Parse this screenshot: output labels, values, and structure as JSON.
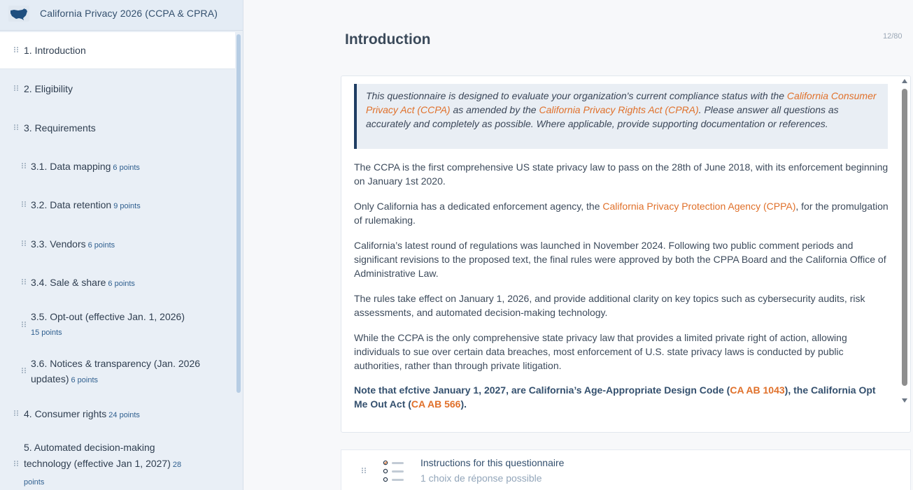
{
  "app": {
    "title": "California Privacy 2026 (CCPA & CPRA)"
  },
  "sidebar": {
    "items": [
      {
        "label": "1. Introduction",
        "points": ""
      },
      {
        "label": "2. Eligibility",
        "points": ""
      },
      {
        "label": "3. Requirements",
        "points": ""
      },
      {
        "label": "3.1. Data mapping",
        "points": "6 points"
      },
      {
        "label": "3.2. Data retention",
        "points": "9 points"
      },
      {
        "label": "3.3. Vendors",
        "points": "6 points"
      },
      {
        "label": "3.4. Sale & share",
        "points": "6 points"
      },
      {
        "label": "3.5. Opt-out (effective Jan. 1, 2026)",
        "points": "15 points"
      },
      {
        "label": "3.6. Notices & transparency (Jan. 2026 updates)",
        "points": "6 points"
      },
      {
        "label": "4. Consumer rights",
        "points": "24 points"
      },
      {
        "label": "5. Automated decision-making technology (effective Jan 1, 2027)",
        "points": "28 points"
      }
    ]
  },
  "main": {
    "title": "Introduction",
    "counter": "12/80",
    "quote": {
      "t1": "This questionnaire is designed to evaluate your organization's current compliance status with the ",
      "link1": "California Consumer Privacy Act (CCPA)",
      "t2": " as amended by the ",
      "link2": "California Privacy Rights Act (CPRA)",
      "t3": ". Please answer all questions as accurately and completely as possible. Where applicable, provide supporting documentation or references."
    },
    "p1": "The CCPA is the first comprehensive US state privacy law to pass on the 28th of June 2018, with its enforcement beginning on January 1st 2020.",
    "p2": {
      "t1": "Only California has a dedicated enforcement agency, the ",
      "link": "California Privacy Protection Agency (CPPA)",
      "t2": ", for the promulgation of rulemaking."
    },
    "p3": "California’s latest round of regulations was launched in November 2024. Following two public comment periods and significant revisions to the proposed text, the final rules were approved by both the CPPA Board and the California Office of Administrative Law.",
    "p4": "The rules take effect on January 1, 2026, and provide additional clarity on key topics such as cybersecurity audits, risk assessments, and automated decision-making technology.",
    "p5": "While the CCPA is the only comprehensive state privacy law that provides a limited private right of action, allowing individuals to sue over certain data breaches, most enforcement of U.S. state privacy laws is conducted by public authorities, rather than through private litigation.",
    "note": {
      "t1": "Note that efctive January 1, 2027, are California’s Age-Appropriate Design Code (",
      "link1": "CA AB 1043",
      "t2": "), the California Opt Me Out Act (",
      "link2": "CA AB 566",
      "t3": ")."
    },
    "instructions": {
      "title": "Instructions for this questionnaire",
      "subtitle": "1 choix de réponse possible"
    }
  },
  "colors": {
    "accent": "#e0702a",
    "navy": "#1f3d63",
    "sidebar_bg": "#e9eff6"
  },
  "icons": [
    "us-map-icon",
    "drag-handle-icon",
    "list-icon"
  ]
}
